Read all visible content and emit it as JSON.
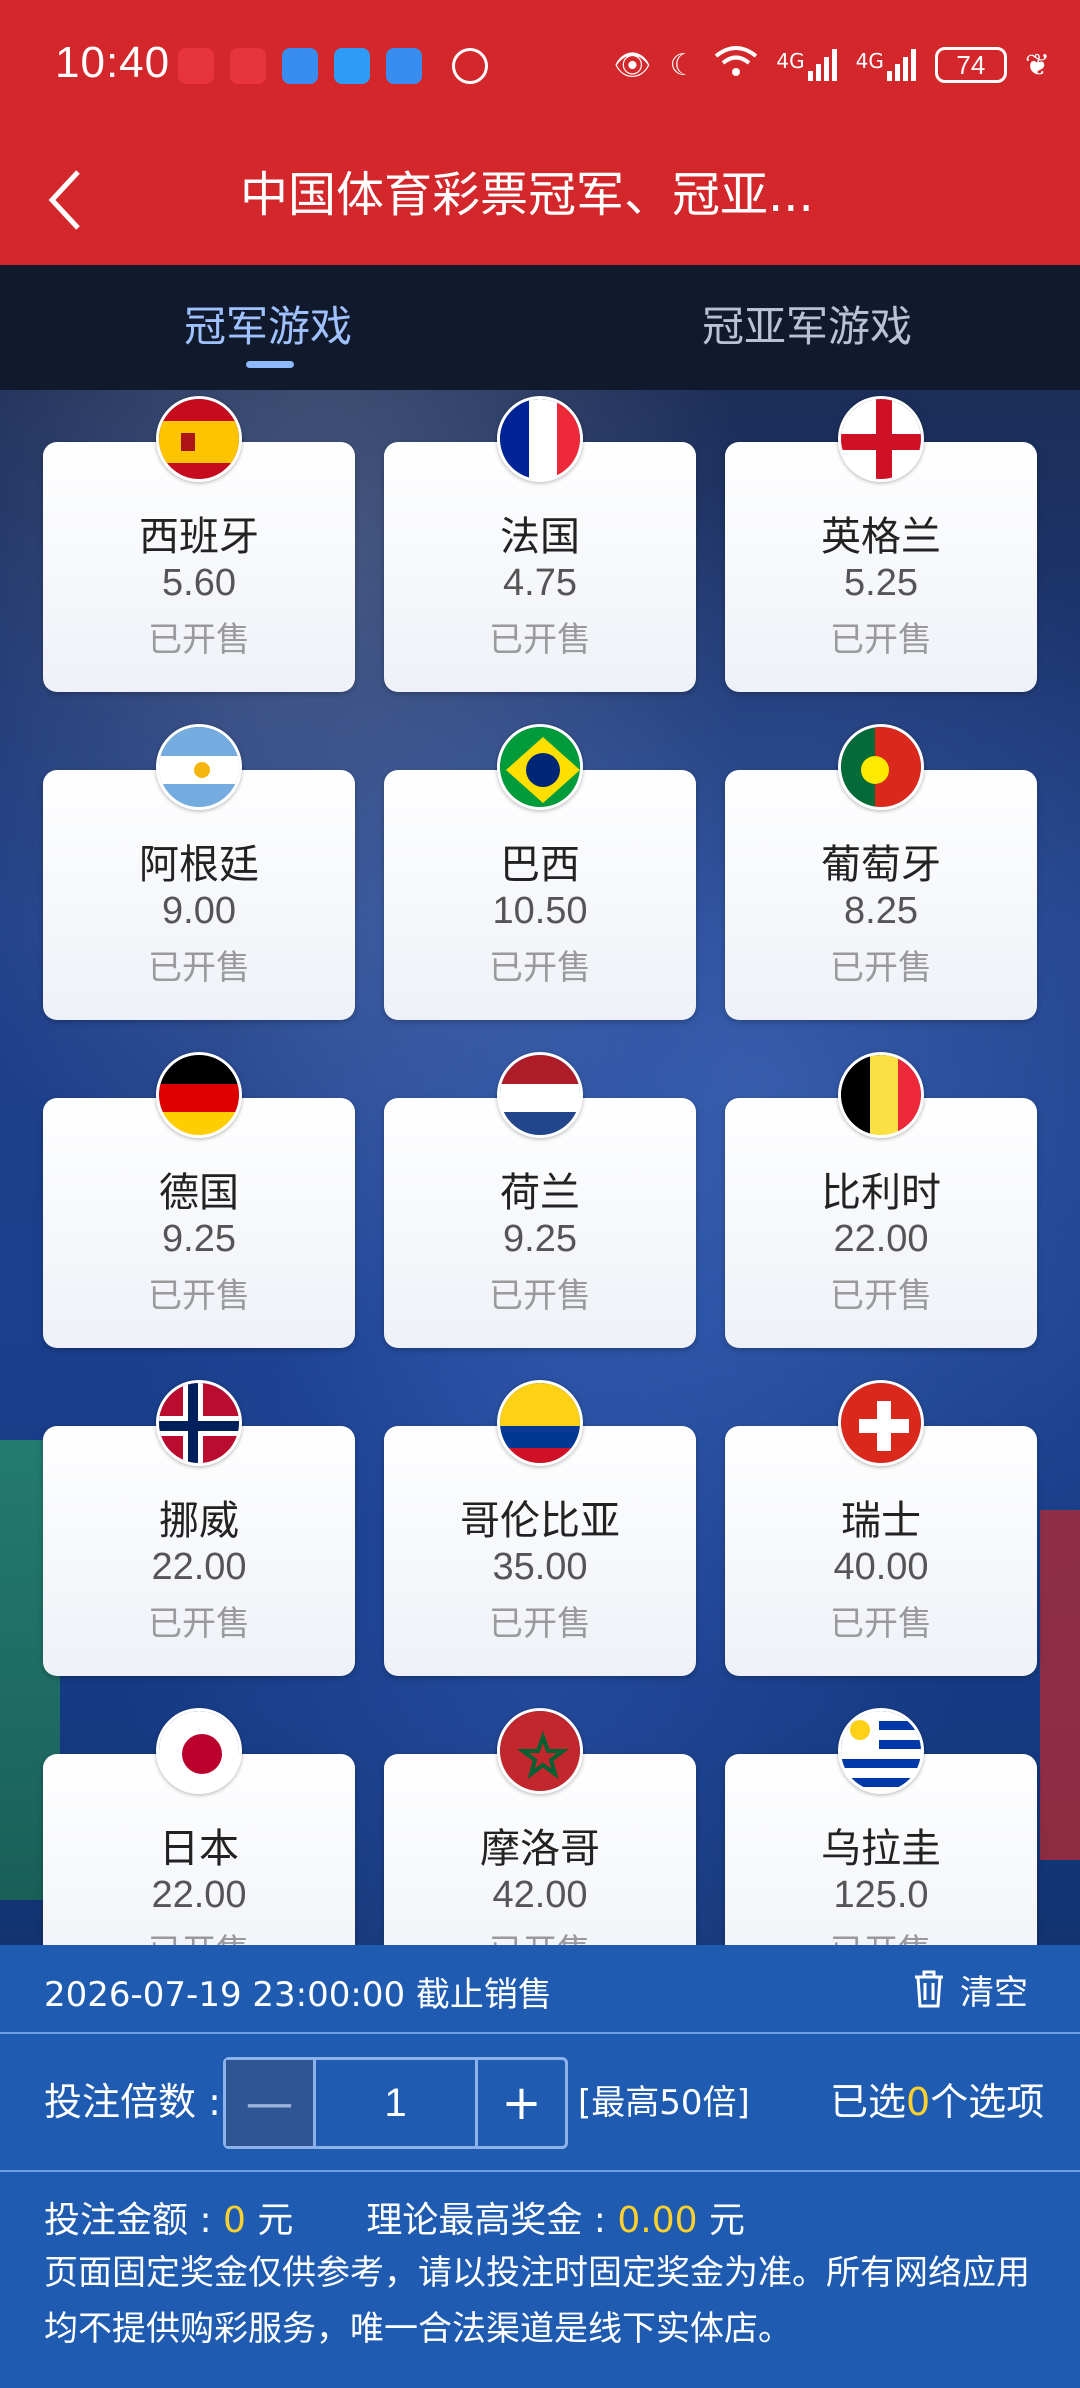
{
  "status_bar": {
    "time": "10:40",
    "network_labels": [
      "4G",
      "4G"
    ],
    "battery": "74"
  },
  "header": {
    "title": "中国体育彩票冠军、冠亚..."
  },
  "tabs": [
    {
      "label": "冠军游戏",
      "active": true
    },
    {
      "label": "冠亚军游戏",
      "active": false
    }
  ],
  "teams": [
    {
      "name": "西班牙",
      "odds": "5.60",
      "status": "已开售",
      "flag": "spain-flag-icon"
    },
    {
      "name": "法国",
      "odds": "4.75",
      "status": "已开售",
      "flag": "france-flag-icon"
    },
    {
      "name": "英格兰",
      "odds": "5.25",
      "status": "已开售",
      "flag": "england-flag-icon"
    },
    {
      "name": "阿根廷",
      "odds": "9.00",
      "status": "已开售",
      "flag": "argentina-flag-icon"
    },
    {
      "name": "巴西",
      "odds": "10.50",
      "status": "已开售",
      "flag": "brazil-flag-icon"
    },
    {
      "name": "葡萄牙",
      "odds": "8.25",
      "status": "已开售",
      "flag": "portugal-flag-icon"
    },
    {
      "name": "德国",
      "odds": "9.25",
      "status": "已开售",
      "flag": "germany-flag-icon"
    },
    {
      "name": "荷兰",
      "odds": "9.25",
      "status": "已开售",
      "flag": "netherlands-flag-icon"
    },
    {
      "name": "比利时",
      "odds": "22.00",
      "status": "已开售",
      "flag": "belgium-flag-icon"
    },
    {
      "name": "挪威",
      "odds": "22.00",
      "status": "已开售",
      "flag": "norway-flag-icon"
    },
    {
      "name": "哥伦比亚",
      "odds": "35.00",
      "status": "已开售",
      "flag": "colombia-flag-icon"
    },
    {
      "name": "瑞士",
      "odds": "40.00",
      "status": "已开售",
      "flag": "switzerland-flag-icon"
    },
    {
      "name": "日本",
      "odds": "22.00",
      "status": "已开售",
      "flag": "japan-flag-icon"
    },
    {
      "name": "摩洛哥",
      "odds": "42.00",
      "status": "已开售",
      "flag": "morocco-flag-icon"
    },
    {
      "name": "乌拉圭",
      "odds": "125.0",
      "status": "已开售",
      "flag": "uruguay-flag-icon"
    }
  ],
  "bottom": {
    "deadline": "2026-07-19 23:00:00 截止销售",
    "clear_label": "清空",
    "multiplier_label": "投注倍数 :",
    "multiplier_minus": "—",
    "multiplier_value": "1",
    "multiplier_plus": "+",
    "max_multiplier": "[最高50倍]",
    "selected_prefix": "已选",
    "selected_count": "0",
    "selected_suffix": "个选项",
    "amount_label": "投注金额 :",
    "amount_value": "0",
    "amount_unit": "元",
    "prize_label": "理论最高奖金 :",
    "prize_value": "0.00",
    "prize_unit": "元",
    "disclaimer": "页面固定奖金仅供参考，请以投注时固定奖金为准。所有网络应用均不提供购彩服务，唯一合法渠道是线下实体店。"
  },
  "colors": {
    "header_red": "#d3272b",
    "tab_bg": "#111a2c",
    "tab_active": "#9fc2ff",
    "panel_blue": "#1f5bb0",
    "highlight_yellow": "#ffd12e"
  }
}
